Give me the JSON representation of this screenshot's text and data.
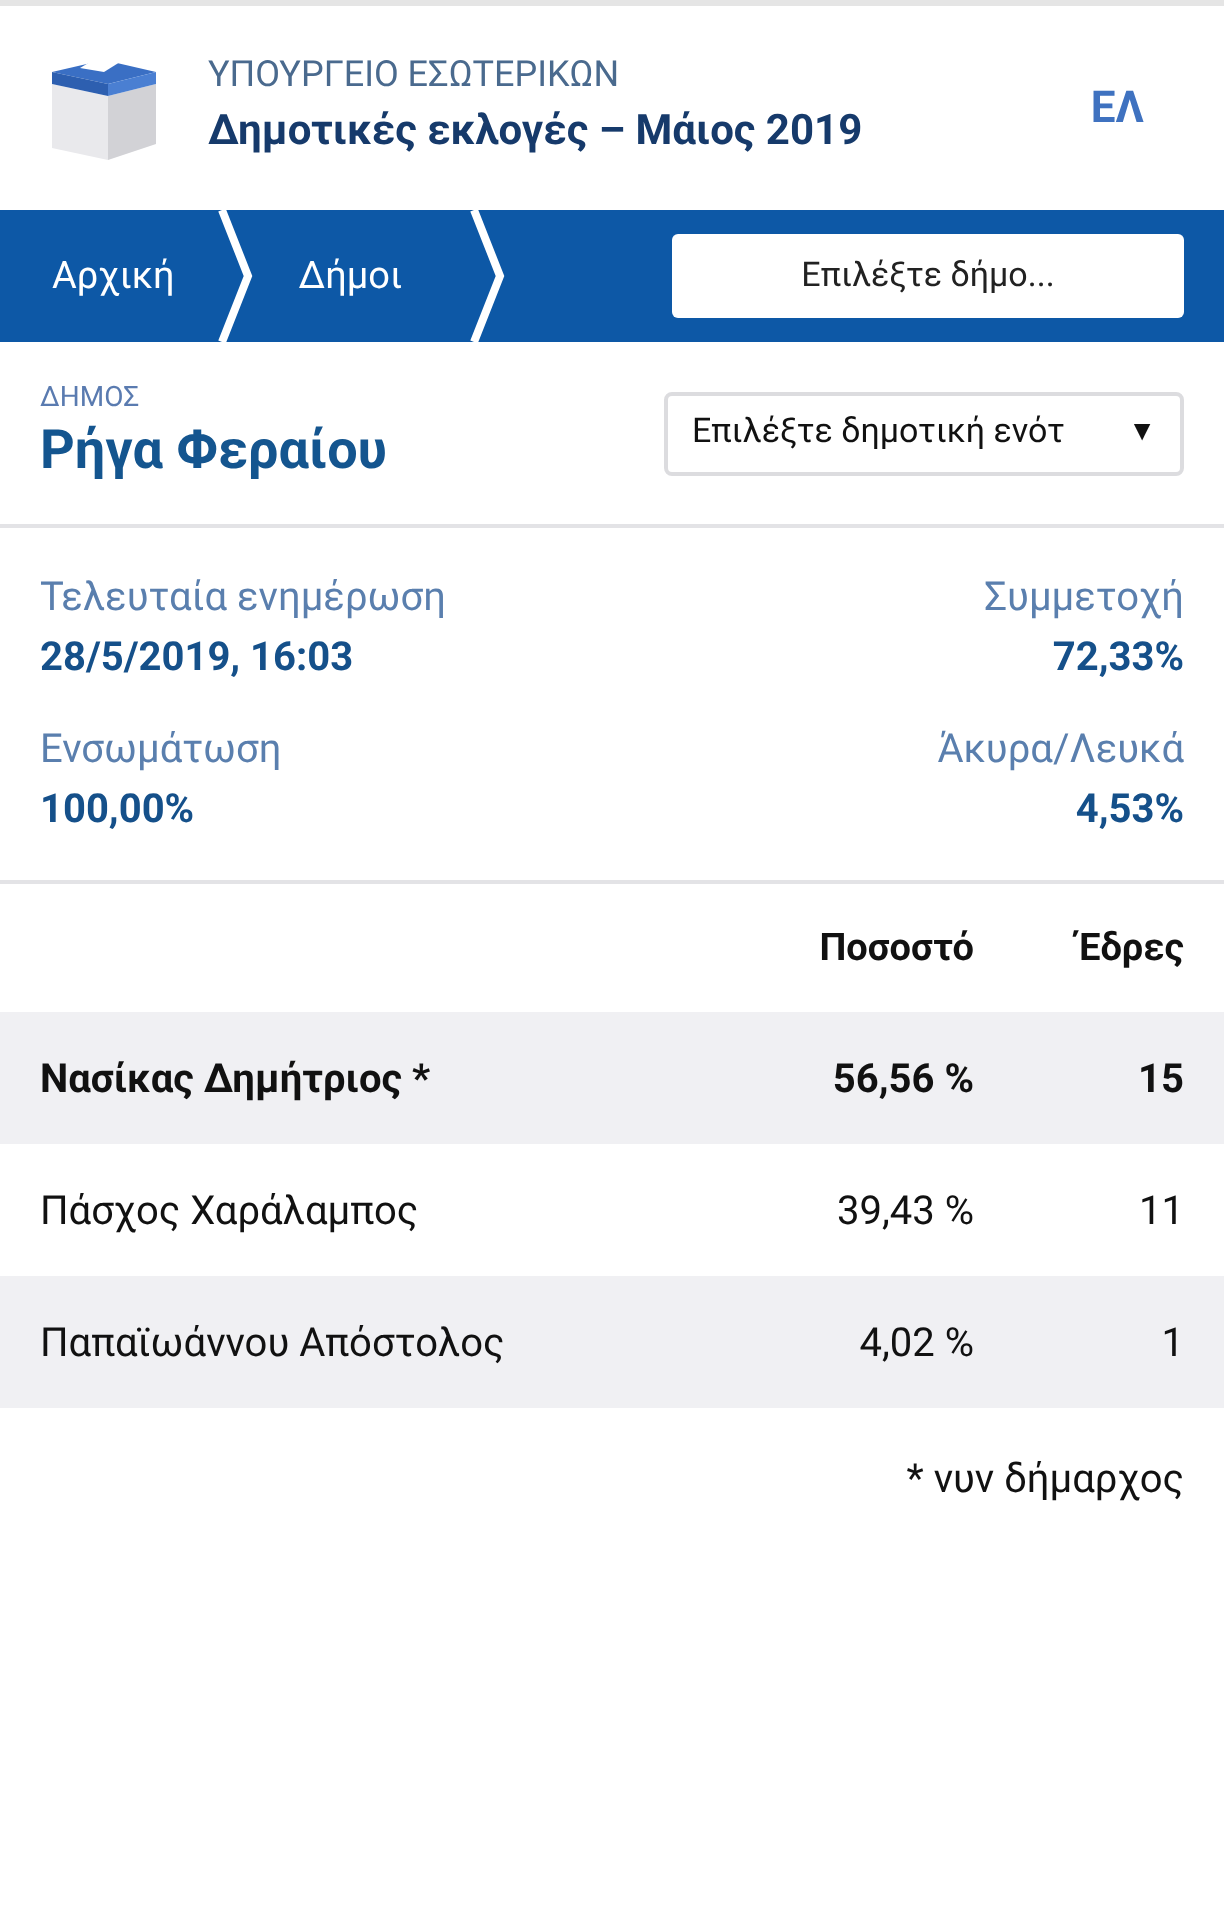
{
  "header": {
    "ministry": "ΥΠΟΥΡΓΕΙΟ ΕΣΩΤΕΡΙΚΩΝ",
    "title": "Δημοτικές εκλογές – Μάιος 2019",
    "language": "ΕΛ"
  },
  "breadcrumbs": [
    {
      "label": "Αρχική"
    },
    {
      "label": "Δήμοι"
    }
  ],
  "municipality_picker": {
    "placeholder": "Επιλέξτε δήμο..."
  },
  "municipality": {
    "caption": "ΔΗΜΟΣ",
    "name": "Ρήγα Φεραίου"
  },
  "unit_select": {
    "value": "Επιλέξτε δημοτική ενότ",
    "caret": "▼"
  },
  "stats": [
    {
      "label": "Τελευταία ενημέρωση",
      "value": "28/5/2019, 16:03"
    },
    {
      "label": "Συμμετοχή",
      "value": "72,33%"
    },
    {
      "label": "Ενσωμάτωση",
      "value": "100,00%"
    },
    {
      "label": "Άκυρα/Λευκά",
      "value": "4,53%"
    }
  ],
  "table": {
    "columns": [
      "Ποσοστό",
      "Έδρες"
    ],
    "rows": [
      {
        "name": "Νασίκας Δημήτριος *",
        "percent": "56,56 %",
        "seats": "15",
        "winner": true
      },
      {
        "name": "Πάσχος Χαράλαμπος",
        "percent": "39,43 %",
        "seats": "11",
        "winner": false
      },
      {
        "name": "Παπαϊωάννου Απόστολος",
        "percent": "4,02 %",
        "seats": "1",
        "winner": false
      }
    ]
  },
  "footnote": "* νυν δήμαρχος"
}
